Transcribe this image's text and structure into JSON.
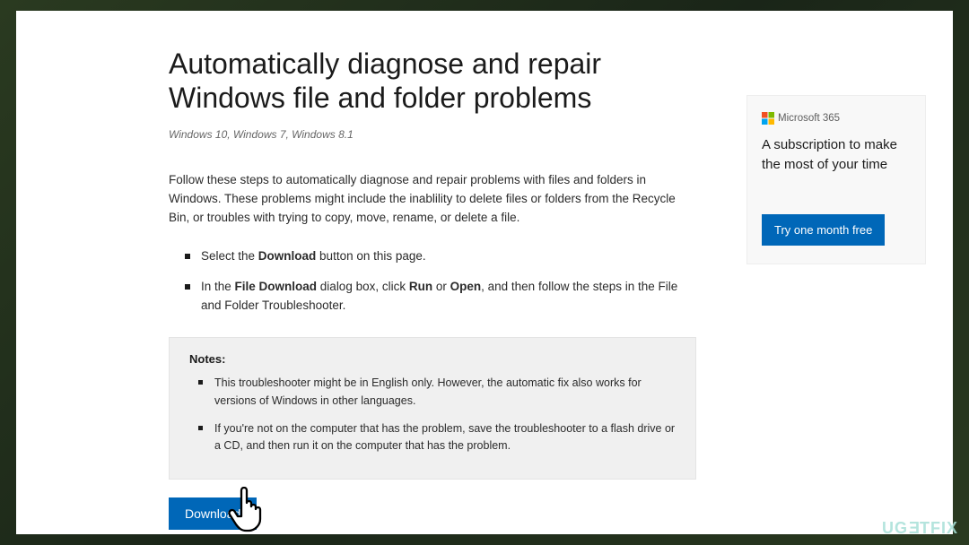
{
  "main": {
    "title": "Automatically diagnose and repair Windows file and folder problems",
    "subtitle": "Windows 10, Windows 7, Windows 8.1",
    "intro": "Follow these steps to automatically diagnose and repair problems with files and folders in Windows. These problems might include the inablility to delete files or folders from the Recycle Bin, or troubles with trying to copy, move, rename, or delete a file.",
    "step1_a": "Select the ",
    "step1_b": "Download",
    "step1_c": " button on this page.",
    "step2_a": "In the ",
    "step2_b": "File Download",
    "step2_c": " dialog box, click ",
    "step2_d": "Run",
    "step2_e": " or ",
    "step2_f": "Open",
    "step2_g": ", and then follow the steps in the File and Folder Troubleshooter.",
    "notes_head": "Notes:",
    "note1": "This troubleshooter might be in English only. However, the automatic fix also works for versions of Windows in other languages.",
    "note2": "If you're not on the computer that has the problem, save the troubleshooter to a flash drive or a CD, and then run it on the computer that has the problem.",
    "download_label": "Download"
  },
  "promo": {
    "logo_text": "Microsoft 365",
    "text": "A subscription to make the most of your time",
    "cta_label": "Try one month free"
  },
  "watermark": {
    "text": "UGETFIX"
  }
}
